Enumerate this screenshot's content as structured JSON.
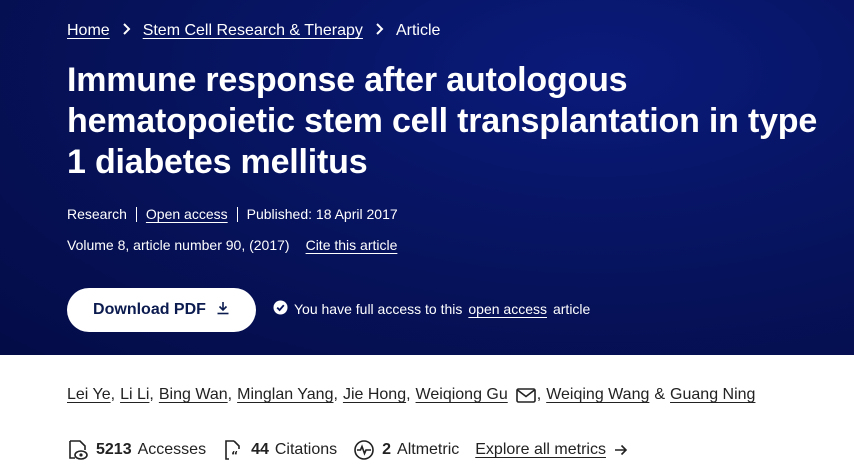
{
  "breadcrumb": {
    "home": "Home",
    "journal": "Stem Cell Research & Therapy",
    "current": "Article"
  },
  "article": {
    "title": "Immune response after autologous hematopoietic stem cell transplantation in type 1 diabetes mellitus",
    "type": "Research",
    "access": "Open access",
    "published": "Published: 18 April 2017",
    "volume": "Volume 8, article number 90, (2017)",
    "cite": "Cite this article"
  },
  "download": {
    "label": "Download PDF"
  },
  "access_note": {
    "prefix": "You have full access to this",
    "link": "open access",
    "suffix": "article"
  },
  "authors": [
    "Lei Ye",
    "Li Li",
    "Bing Wan",
    "Minglan Yang",
    "Jie Hong",
    "Weiqiong Gu",
    "Weiqing Wang",
    "Guang Ning"
  ],
  "metrics": {
    "accesses_value": "5213",
    "accesses_label": "Accesses",
    "citations_value": "44",
    "citations_label": "Citations",
    "altmetric_value": "2",
    "altmetric_label": "Altmetric",
    "explore": "Explore all metrics"
  },
  "colors": {
    "hero_bg": "#06125a",
    "button_text": "#0b1b4f",
    "body_text": "#222222"
  }
}
